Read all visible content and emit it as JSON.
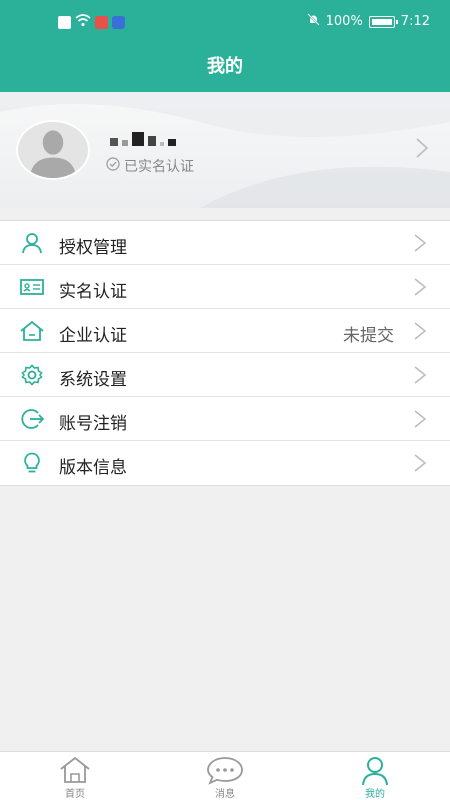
{
  "status_bar": {
    "battery": "100%",
    "time": "7:12"
  },
  "header": {
    "title": "我的"
  },
  "profile": {
    "verified_text": "已实名认证"
  },
  "menu": {
    "items": [
      {
        "label": "授权管理",
        "value": ""
      },
      {
        "label": "实名认证",
        "value": ""
      },
      {
        "label": "企业认证",
        "value": "未提交"
      },
      {
        "label": "系统设置",
        "value": ""
      },
      {
        "label": "账号注销",
        "value": ""
      },
      {
        "label": "版本信息",
        "value": ""
      }
    ]
  },
  "tabbar": {
    "tabs": [
      {
        "label": "首页"
      },
      {
        "label": "消息"
      },
      {
        "label": "我的"
      }
    ],
    "active_index": 2
  },
  "colors": {
    "accent": "#2bb199"
  }
}
